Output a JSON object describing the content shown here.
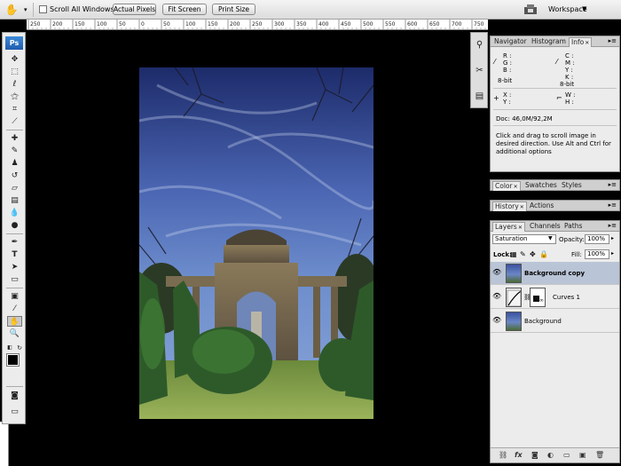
{
  "options_bar": {
    "scroll_all_windows": "Scroll All Windows",
    "actual_pixels": "Actual Pixels",
    "fit_screen": "Fit Screen",
    "print_size": "Print Size",
    "workspace": "Workspace"
  },
  "ruler": {
    "labels": [
      "250",
      "200",
      "150",
      "100",
      "50",
      "0",
      "50",
      "100",
      "150",
      "200",
      "250",
      "300",
      "350",
      "400",
      "450",
      "500",
      "550",
      "600",
      "650",
      "700",
      "750"
    ]
  },
  "toolbox": {
    "logo": "Ps"
  },
  "nav_panel": {
    "tabs": [
      "Navigator",
      "Histogram",
      "Info"
    ],
    "info": {
      "r": "R :",
      "g": "G :",
      "b": "B :",
      "bit1": "8-bit",
      "c": "C :",
      "m": "M :",
      "y": "Y :",
      "k": "K :",
      "bit2": "8-bit",
      "x": "X :",
      "y2": "Y :",
      "w": "W :",
      "h": "H :",
      "doc": "Doc: 46,0M/92,2M",
      "hint": "Click and drag to scroll image in desired direction. Use Alt and Ctrl for additional options"
    }
  },
  "color_panel": {
    "tabs": [
      "Color",
      "Swatches",
      "Styles"
    ]
  },
  "history_panel": {
    "tabs": [
      "History",
      "Actions"
    ]
  },
  "layers_panel": {
    "tabs": [
      "Layers",
      "Channels",
      "Paths"
    ],
    "blend_mode": "Saturation",
    "opacity_label": "Opacity:",
    "opacity": "100%",
    "lock_label": "Lock:",
    "fill_label": "Fill:",
    "fill": "100%",
    "layers": [
      "Background copy",
      "Curves 1",
      "Background"
    ]
  }
}
